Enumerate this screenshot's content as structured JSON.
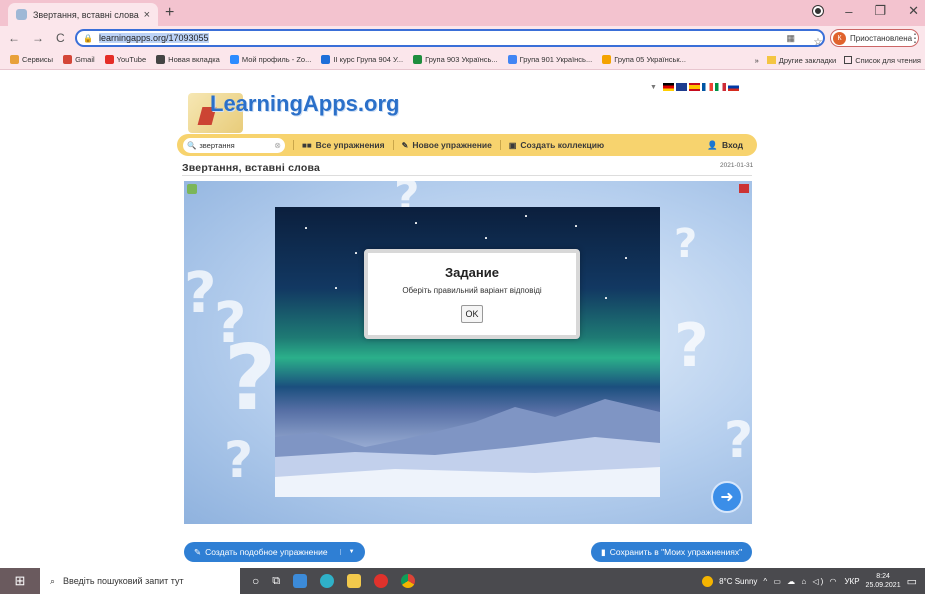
{
  "browser": {
    "tab_title": "Звертання, вставні слова",
    "tab_close": "×",
    "new_tab": "+",
    "url": "learningapps.org/17093055",
    "profile_label": "Приостановлена",
    "profile_initial": "К"
  },
  "bookmarks": {
    "items": [
      {
        "label": "Сервисы",
        "color": "#e8a13a"
      },
      {
        "label": "Gmail",
        "color": "#d44638"
      },
      {
        "label": "YouTube",
        "color": "#e52d27"
      },
      {
        "label": "Новая вкладка",
        "color": "#444"
      },
      {
        "label": "Мой профиль - Zo...",
        "color": "#2d8cff"
      },
      {
        "label": "II курс Група 904 У...",
        "color": "#1e6fd9"
      },
      {
        "label": "Група 903 Українсь...",
        "color": "#1e8e3e"
      },
      {
        "label": "Група 901 Українсь...",
        "color": "#4285f4"
      },
      {
        "label": "Група 05 Українськ...",
        "color": "#f4a300"
      }
    ],
    "more": "»",
    "other": "Другие закладки",
    "reading_list": "Список для чтения"
  },
  "site": {
    "logo_text": "LearningApps.org",
    "search_value": "звертання",
    "menu": {
      "all_exercises": "Все упражнения",
      "new_exercise": "Новое упражнение",
      "create_collection": "Создать коллекцию",
      "login": "Вход"
    },
    "exercise_title": "Звертання, вставні слова",
    "exercise_date": "2021-01-31"
  },
  "dialog": {
    "title": "Задание",
    "message": "Оберіть правильний варіант відповіді",
    "ok": "OK"
  },
  "actions": {
    "create_similar": "Создать подобное упражнение",
    "save_to_mine": "Сохранить в \"Моих упражнениях\""
  },
  "taskbar": {
    "search_placeholder": "Введіть пошуковий запит тут",
    "weather": "8°C  Sunny",
    "lang": "УКР",
    "time": "8:24",
    "date": "25.09.2021"
  }
}
